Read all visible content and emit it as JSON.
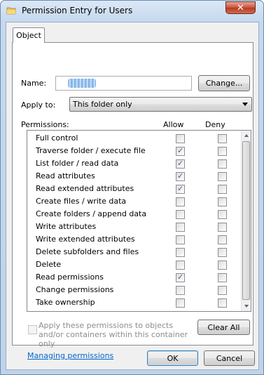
{
  "window": {
    "title": "Permission Entry for Users",
    "close_glyph": "✕"
  },
  "tabs": [
    {
      "label": "Object"
    }
  ],
  "name": {
    "label": "Name:",
    "value": "",
    "change_button": "Change..."
  },
  "apply_to": {
    "label": "Apply to:",
    "selected": "This folder only"
  },
  "permissions": {
    "label": "Permissions:",
    "col_allow": "Allow",
    "col_deny": "Deny",
    "rows": [
      {
        "label": "Full control",
        "allow": false,
        "deny": false
      },
      {
        "label": "Traverse folder / execute file",
        "allow": true,
        "deny": false
      },
      {
        "label": "List folder / read data",
        "allow": true,
        "deny": false
      },
      {
        "label": "Read attributes",
        "allow": true,
        "deny": false
      },
      {
        "label": "Read extended attributes",
        "allow": true,
        "deny": false
      },
      {
        "label": "Create files / write data",
        "allow": false,
        "deny": false
      },
      {
        "label": "Create folders / append data",
        "allow": false,
        "deny": false
      },
      {
        "label": "Write attributes",
        "allow": false,
        "deny": false
      },
      {
        "label": "Write extended attributes",
        "allow": false,
        "deny": false
      },
      {
        "label": "Delete subfolders and files",
        "allow": false,
        "deny": false
      },
      {
        "label": "Delete",
        "allow": false,
        "deny": false
      },
      {
        "label": "Read permissions",
        "allow": true,
        "deny": false
      },
      {
        "label": "Change permissions",
        "allow": false,
        "deny": false
      },
      {
        "label": "Take ownership",
        "allow": false,
        "deny": false
      }
    ]
  },
  "apply_option": {
    "label": "Apply these permissions to objects and/or containers within this container only",
    "checked": false,
    "enabled": false
  },
  "clear_all_button": "Clear All",
  "managing_link": "Managing permissions",
  "footer": {
    "ok": "OK",
    "cancel": "Cancel"
  },
  "colors": {
    "link": "#0066cc",
    "check": "#4a5f97",
    "title_bar": "#c5d8ee",
    "close": "#c7503a"
  },
  "icons": {
    "title": "folder-icon",
    "close": "close-icon"
  }
}
